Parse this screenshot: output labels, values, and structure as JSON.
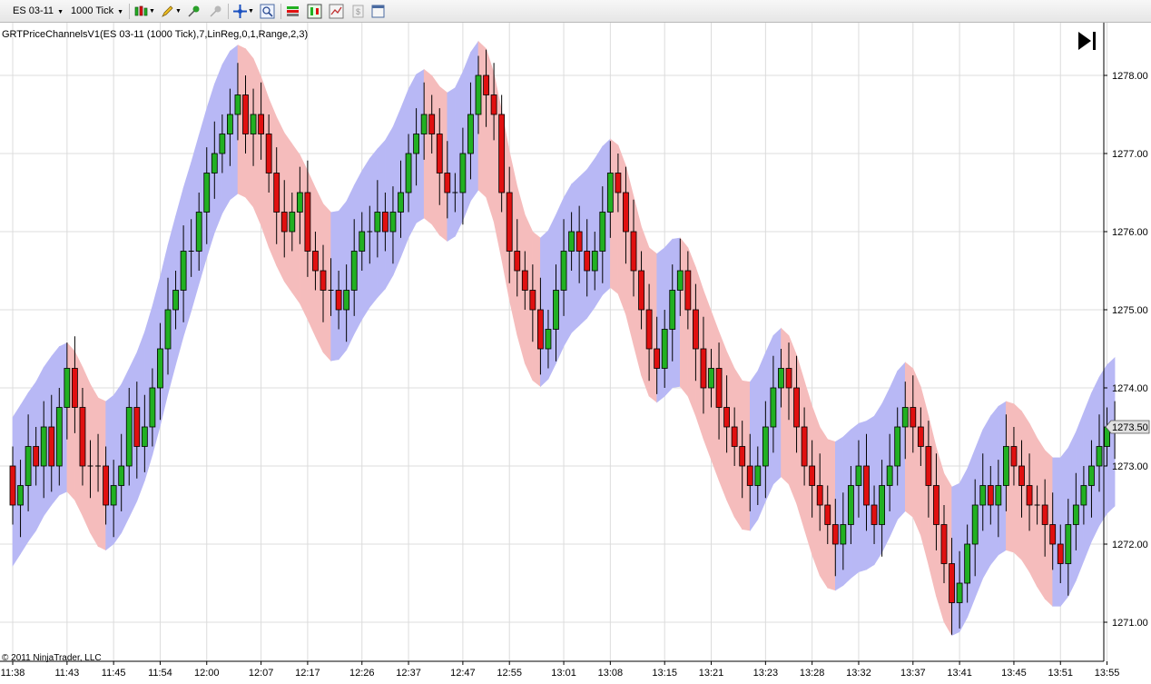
{
  "toolbar": {
    "instrument": "ES 03-11",
    "period": "1000 Tick",
    "icons": [
      "candlestick-style-icon",
      "draw-pencil-icon",
      "pin-icon",
      "pin-disabled-icon",
      "crosshair-icon",
      "zoom-icon",
      "instrument-properties-icon",
      "data-series-icon",
      "indicator-icon",
      "strategy-icon",
      "chart-properties-icon"
    ]
  },
  "indicator_label": "GRTPriceChannelsV1(ES 03-11 (1000 Tick),7,LinReg,0,1,Range,2,3)",
  "copyright": "© 2011 NinjaTrader, LLC",
  "colors": {
    "up_candle": "#22b022",
    "down_candle": "#e01010",
    "channel_up": "#b8b8f5",
    "channel_down": "#f5bcbc",
    "grid": "#dcdcdc",
    "last_price_tag": "#e0e0e0"
  },
  "chart_data": {
    "type": "candlestick",
    "y_ticks": [
      1271.0,
      1272.0,
      1273.0,
      1274.0,
      1275.0,
      1276.0,
      1277.0,
      1278.0
    ],
    "y_tick_labels": [
      "1271.00",
      "1272.00",
      "1273.00",
      "1274.00",
      "1275.00",
      "1276.00",
      "1277.00",
      "1278.00"
    ],
    "ylim": [
      1270.55,
      1279.05
    ],
    "x_tick_labels": [
      "11:38",
      "11:43",
      "11:45",
      "11:54",
      "12:00",
      "12:07",
      "12:17",
      "12:26",
      "12:37",
      "12:47",
      "12:55",
      "13:01",
      "13:08",
      "13:15",
      "13:21",
      "13:23",
      "13:28",
      "13:32",
      "13:37",
      "13:41",
      "13:45",
      "13:51",
      "13:55"
    ],
    "x_tick_bar_index": [
      0,
      7,
      13,
      19,
      25,
      32,
      38,
      45,
      51,
      58,
      64,
      71,
      77,
      84,
      90,
      97,
      103,
      109,
      116,
      122,
      129,
      135,
      141
    ],
    "last_price_label": "1273.50",
    "last_price": 1273.5,
    "bar_count": 143,
    "closes": [
      1272.5,
      1272.75,
      1273.25,
      1273.0,
      1273.5,
      1273.0,
      1273.75,
      1274.25,
      1273.75,
      1273.0,
      1273.0,
      1273.0,
      1272.5,
      1272.75,
      1273.0,
      1273.75,
      1273.25,
      1273.5,
      1274.0,
      1274.5,
      1275.0,
      1275.25,
      1275.75,
      1275.75,
      1276.25,
      1276.75,
      1277.0,
      1277.25,
      1277.5,
      1277.75,
      1277.25,
      1277.5,
      1277.25,
      1276.75,
      1276.25,
      1276.0,
      1276.25,
      1276.5,
      1275.75,
      1275.5,
      1275.25,
      1275.25,
      1275.0,
      1275.25,
      1275.75,
      1276.0,
      1276.0,
      1276.25,
      1276.0,
      1276.25,
      1276.5,
      1277.0,
      1277.25,
      1277.5,
      1277.25,
      1276.75,
      1276.5,
      1276.5,
      1277.0,
      1277.5,
      1278.0,
      1277.75,
      1277.5,
      1276.5,
      1275.75,
      1275.5,
      1275.25,
      1275.0,
      1274.5,
      1274.75,
      1275.25,
      1275.75,
      1276.0,
      1275.75,
      1275.5,
      1275.75,
      1276.25,
      1276.75,
      1276.5,
      1276.0,
      1275.5,
      1275.0,
      1274.5,
      1274.25,
      1274.75,
      1275.25,
      1275.5,
      1275.0,
      1274.5,
      1274.0,
      1274.25,
      1273.75,
      1273.5,
      1273.25,
      1273.0,
      1272.75,
      1273.0,
      1273.5,
      1274.0,
      1274.25,
      1274.0,
      1273.5,
      1273.0,
      1272.75,
      1272.5,
      1272.25,
      1272.0,
      1272.25,
      1272.75,
      1273.0,
      1272.5,
      1272.25,
      1272.75,
      1273.0,
      1273.5,
      1273.75,
      1273.5,
      1273.25,
      1272.75,
      1272.25,
      1271.75,
      1271.25,
      1271.5,
      1272.0,
      1272.5,
      1272.75,
      1272.5,
      1272.75,
      1273.25,
      1273.0,
      1272.75,
      1272.5,
      1272.5,
      1272.25,
      1272.0,
      1271.75,
      1272.25,
      1272.5,
      1272.75,
      1273.0,
      1273.25,
      1273.5,
      1273.5
    ]
  }
}
